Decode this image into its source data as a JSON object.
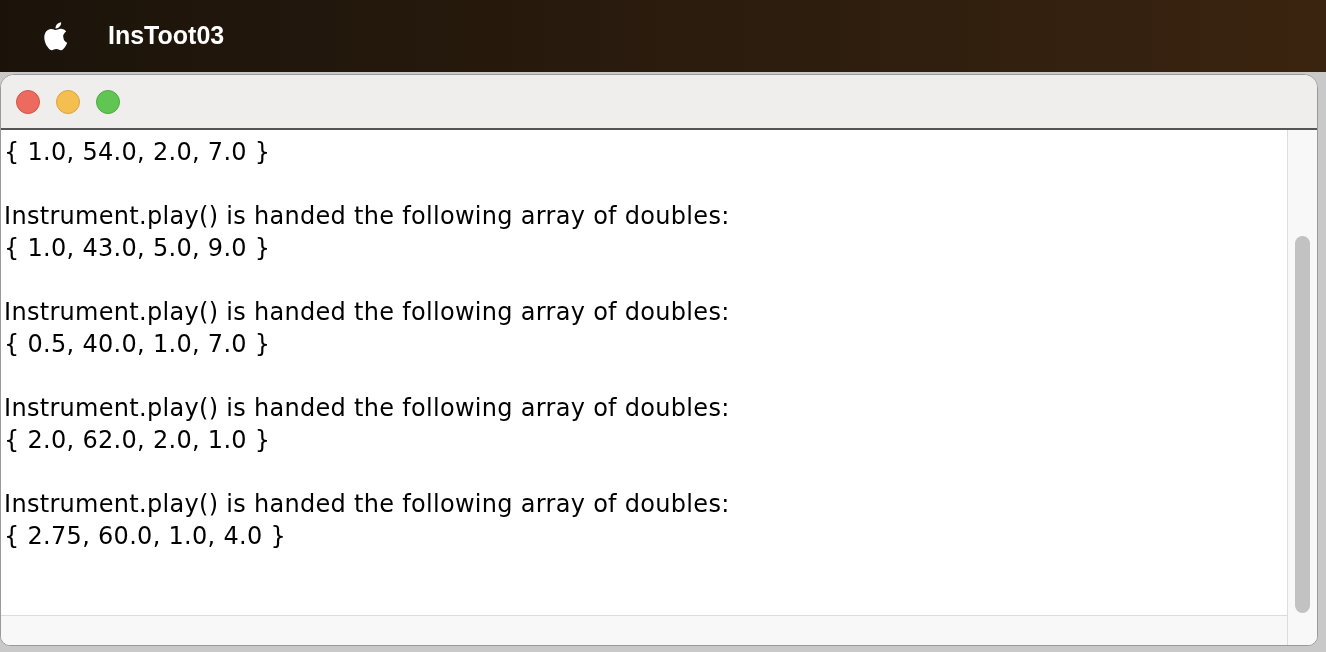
{
  "menu_bar": {
    "app_name": "InsToot03"
  },
  "console": {
    "blocks": [
      {
        "lines": [
          "{ 1.0, 54.0, 2.0, 7.0 }"
        ]
      },
      {
        "lines": [
          "Instrument.play() is handed the following array of doubles:",
          "{ 1.0, 43.0, 5.0, 9.0 }"
        ]
      },
      {
        "lines": [
          "Instrument.play() is handed the following array of doubles:",
          "{ 0.5, 40.0, 1.0, 7.0 }"
        ]
      },
      {
        "lines": [
          "Instrument.play() is handed the following array of doubles:",
          "{ 2.0, 62.0, 2.0, 1.0 }"
        ]
      },
      {
        "lines": [
          "Instrument.play() is handed the following array of doubles:",
          "{ 2.75, 60.0, 1.0, 4.0 }"
        ]
      }
    ]
  }
}
